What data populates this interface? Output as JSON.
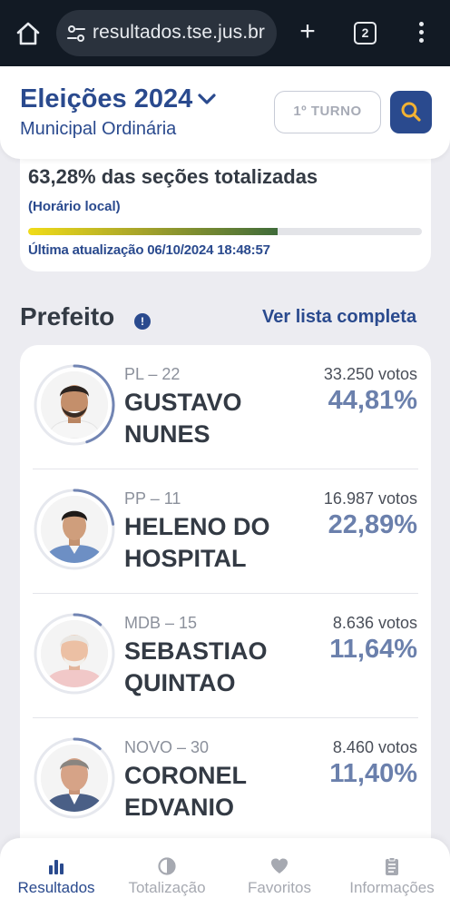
{
  "browser": {
    "url": "resultados.tse.jus.br",
    "tab_count": "2",
    "new_tab_glyph": "+"
  },
  "header": {
    "title": "Eleições 2024",
    "subtitle": "Municipal Ordinária",
    "turno": "1º TURNO"
  },
  "progress": {
    "text": "63,28% das seções totalizadas",
    "local_time": "(Horário local)",
    "fraction": 0.6328,
    "updated": "Última atualização 06/10/2024 18:48:57"
  },
  "section": {
    "title": "Prefeito",
    "info_glyph": "!",
    "link": "Ver lista completa"
  },
  "candidates": [
    {
      "party": "PL – 22",
      "name": "GUSTAVO NUNES",
      "votes": "33.250 votos",
      "percent": "44,81%",
      "share": 0.4481,
      "icon": "candidate-photo"
    },
    {
      "party": "PP – 11",
      "name": "HELENO DO HOSPITAL",
      "votes": "16.987 votos",
      "percent": "22,89%",
      "share": 0.2289,
      "icon": "candidate-photo"
    },
    {
      "party": "MDB – 15",
      "name": "SEBASTIAO QUINTAO",
      "votes": "8.636 votos",
      "percent": "11,64%",
      "share": 0.1164,
      "icon": "candidate-photo"
    },
    {
      "party": "NOVO – 30",
      "name": "CORONEL EDVANIO",
      "votes": "8.460 votos",
      "percent": "11,40%",
      "share": 0.114,
      "icon": "candidate-photo"
    }
  ],
  "nav": [
    {
      "label": "Resultados",
      "icon": "bar-chart-icon",
      "active": true
    },
    {
      "label": "Totalização",
      "icon": "pie-chart-icon",
      "active": false
    },
    {
      "label": "Favoritos",
      "icon": "heart-icon",
      "active": false
    },
    {
      "label": "Informações",
      "icon": "clipboard-icon",
      "active": false
    }
  ],
  "colors": {
    "primary": "#2a4a8e",
    "percent": "#6b80ac",
    "browser_bar": "#121a24"
  }
}
